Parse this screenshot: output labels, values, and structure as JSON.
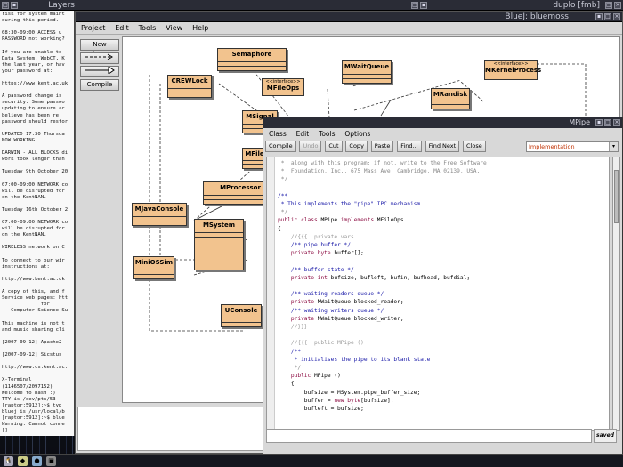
{
  "top_bar": {
    "layers_title": "Layers",
    "duplo_title": "duplo [fmb]",
    "bluej_title": "BlueJ:  bluemoss"
  },
  "bluej": {
    "menu": [
      "Project",
      "Edit",
      "Tools",
      "View",
      "Help"
    ],
    "buttons": {
      "new_class": "New Class...",
      "compile": "Compile"
    }
  },
  "classes": [
    {
      "name": "Semaphore"
    },
    {
      "name": "MWaitQueue"
    },
    {
      "name": "MKernelProcess",
      "stereotype": "<<interface>>"
    },
    {
      "name": "CREWLock"
    },
    {
      "name": "MFileOps",
      "stereotype": "<<interface>>"
    },
    {
      "name": "MRandisk"
    },
    {
      "name": "MSignal"
    },
    {
      "name": "MFile"
    },
    {
      "name": "MProcessor"
    },
    {
      "name": "MJavaConsole"
    },
    {
      "name": "MSystem"
    },
    {
      "name": "MiniOSSim"
    },
    {
      "name": "UConsole"
    }
  ],
  "editor": {
    "title": "MPipe",
    "menu": [
      "Class",
      "Edit",
      "Tools",
      "Options"
    ],
    "toolbar": [
      "Compile",
      "Undo",
      "Cut",
      "Copy",
      "Paste",
      "Find...",
      "Find Next",
      "Close"
    ],
    "view_selector": "Implementation",
    "status_saved": "saved",
    "code_lines": [
      " *  along with this program; if not, write to the Free Software",
      " *  Foundation, Inc., 675 Mass Ave, Cambridge, MA 02139, USA.",
      " */",
      "",
      "/**",
      " * This implements the \"pipe\" IPC mechanism",
      " */",
      "public class MPipe implements MFileOps",
      "{",
      "    //{{{  private vars",
      "    /** pipe buffer */",
      "    private byte buffer[];",
      "",
      "    /** buffer state */",
      "    private int bufsize, bufleft, bufin, bufhead, bufdial;",
      "",
      "    /** waiting readers queue */",
      "    private MWaitQueue blocked_reader;",
      "    /** waiting writers queue */",
      "    private MWaitQueue blocked_writer;",
      "    //}}}",
      "",
      "    //{{{  public MPipe ()",
      "    /**",
      "     * initialises the pipe to its blank state",
      "     */",
      "    public MPipe ()",
      "    {",
      "        bufsize = MSystem.pipe_buffer_size;",
      "        buffer = new byte[bufsize];",
      "        bufleft = bufsize;"
    ]
  },
  "terminal": {
    "lines": [
      "risk for system maint",
      "during this period.",
      "",
      "08:30-09:00 ACCESS u",
      "PASSWORD not working?",
      "",
      "If you are unable to",
      "Data System, WebCT, K",
      "the last year, or hav",
      "your password at:",
      "",
      "https://www.kent.ac.uk",
      "",
      "A password change is",
      "security. Some passwo",
      "updating to ensure ac",
      "believe has been re",
      "password should restor",
      "",
      "UPDATED 17:30 Thursda",
      "NOW WORKING",
      "",
      "DARWIN - ALL BLOCKS di",
      "work took longer than",
      "--------------------",
      "Tuesday 9th October 20",
      "",
      "07:00-09:00 NETWORK co",
      "will be disrupted for",
      "on the KentNAN.",
      "",
      "Tuesday 16th October 2",
      "",
      "07:00-09:00 NETWORK co",
      "will be disrupted for",
      "on the KentNAN.",
      "",
      "WIRELESS network on C",
      "",
      "To connect to our wir",
      "instructions at:",
      "",
      "http://www.kent.ac.uk",
      "",
      "A copy of this, and f",
      "Service web pages: htt",
      "             for",
      "-- Computer Science Su",
      "",
      "This machine is not t",
      "and music sharing cli",
      "",
      "[2007-09-12] Apache2 ",
      "",
      "[2007-09-12] Sicstus ",
      "",
      "http://www.cs.kent.ac.",
      "",
      "X-Terminal",
      "(1146507/2097152)",
      "Welcome to bash :)",
      "TTY is /dev/pts/53",
      "[raptor:5912]:~$ typ",
      "bluej is /usr/local/b",
      "[raptor:5912]:~$ blue",
      "Warning: Cannot conne",
      "[]"
    ]
  }
}
